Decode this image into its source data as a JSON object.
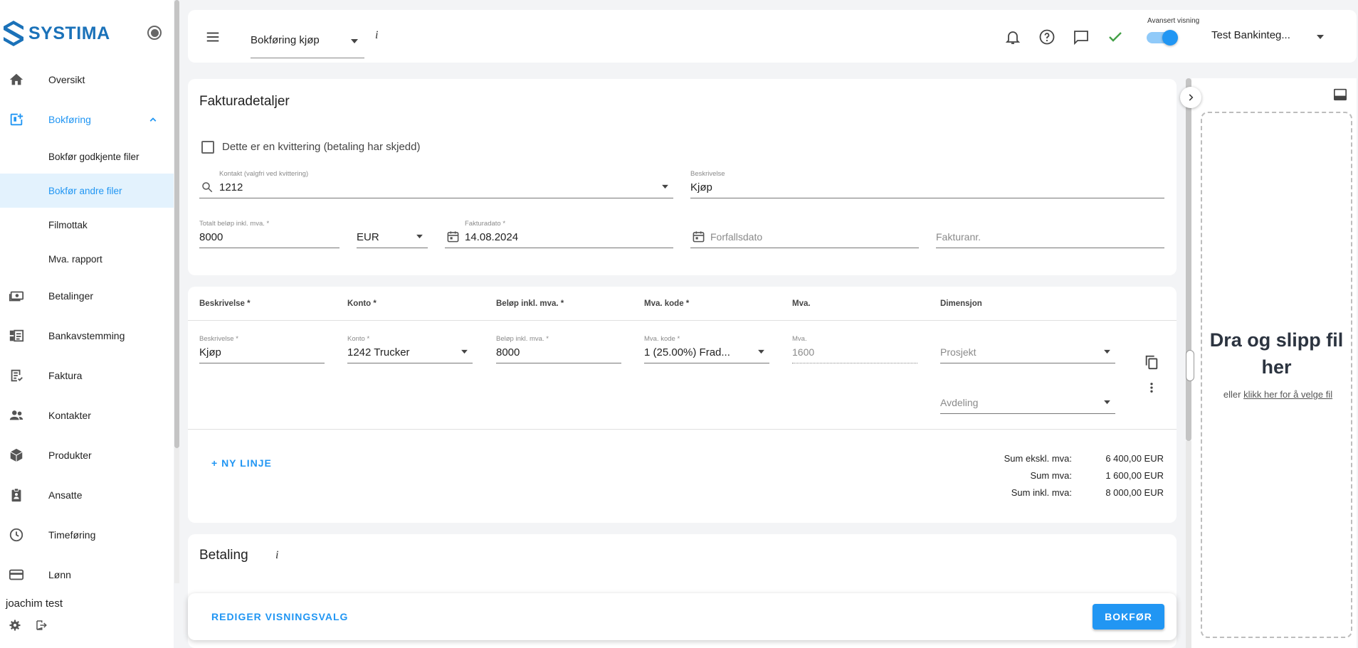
{
  "app": {
    "logo_text": "SYSTIMA"
  },
  "sidebar": {
    "items": [
      {
        "label": "Oversikt",
        "icon": "home-icon"
      },
      {
        "label": "Bokføring",
        "icon": "bookkeeping-icon"
      },
      {
        "label": "Betalinger",
        "icon": "payments-icon"
      },
      {
        "label": "Bankavstemming",
        "icon": "bank-reconciliation-icon"
      },
      {
        "label": "Faktura",
        "icon": "invoice-icon"
      },
      {
        "label": "Kontakter",
        "icon": "contacts-icon"
      },
      {
        "label": "Produkter",
        "icon": "products-icon"
      },
      {
        "label": "Ansatte",
        "icon": "employees-icon"
      },
      {
        "label": "Timeføring",
        "icon": "clock-icon"
      },
      {
        "label": "Lønn",
        "icon": "payroll-icon"
      }
    ],
    "sub_items": [
      {
        "label": "Bokfør godkjente filer"
      },
      {
        "label": "Bokfør andre filer"
      },
      {
        "label": "Filmottak"
      },
      {
        "label": "Mva. rapport"
      }
    ],
    "user_name": "joachim test"
  },
  "topbar": {
    "mode_value": "Bokføring kjøp",
    "info_glyph": "i",
    "toggle_label": "Avansert visning",
    "company": "Test Bankinteg..."
  },
  "invoice": {
    "title": "Fakturadetaljer",
    "receipt_checkbox_label": "Dette er en kvittering (betaling har skjedd)",
    "contact_label": "Kontakt (valgfri ved kvittering)",
    "contact_value": "1212",
    "description_label": "Beskrivelse",
    "description_value": "Kjøp",
    "total_label": "Totalt beløp inkl. mva. *",
    "total_value": "8000",
    "currency_value": "EUR",
    "invoice_date_label": "Fakturadato *",
    "invoice_date_value": "14.08.2024",
    "due_date_placeholder": "Forfallsdato",
    "invoice_number_placeholder": "Fakturanr."
  },
  "lines": {
    "headers": [
      "Beskrivelse *",
      "Konto *",
      "Beløp inkl. mva. *",
      "Mva. kode *",
      "Mva.",
      "Dimensjon"
    ],
    "row": {
      "description_label": "Beskrivelse *",
      "description_value": "Kjøp",
      "account_label": "Konto *",
      "account_value": "1242 Trucker",
      "amount_label": "Beløp inkl. mva. *",
      "amount_value": "8000",
      "vat_code_label": "Mva. kode *",
      "vat_code_value": "1 (25.00%) Frad...",
      "vat_label": "Mva.",
      "vat_value": "1600",
      "project_placeholder": "Prosjekt",
      "department_placeholder": "Avdeling"
    },
    "new_line_label": "+ NY LINJE",
    "sums": [
      {
        "label": "Sum ekskl. mva:",
        "value": "6 400,00 EUR"
      },
      {
        "label": "Sum mva:",
        "value": "1 600,00 EUR"
      },
      {
        "label": "Sum inkl. mva:",
        "value": "8 000,00 EUR"
      }
    ]
  },
  "payment": {
    "title": "Betaling",
    "info_glyph": "i"
  },
  "footer": {
    "edit_view_label": "REDIGER VISNINGSVALG",
    "post_label": "BOKFØR"
  },
  "dropzone": {
    "title": "Dra og slipp fil her",
    "prefix": "eller ",
    "link": "klikk her for å velge fil"
  },
  "colors": {
    "accent": "#2196f3",
    "brand": "#1b72b9",
    "selected_bg": "#e3f2fd",
    "check_green": "#43a047"
  }
}
